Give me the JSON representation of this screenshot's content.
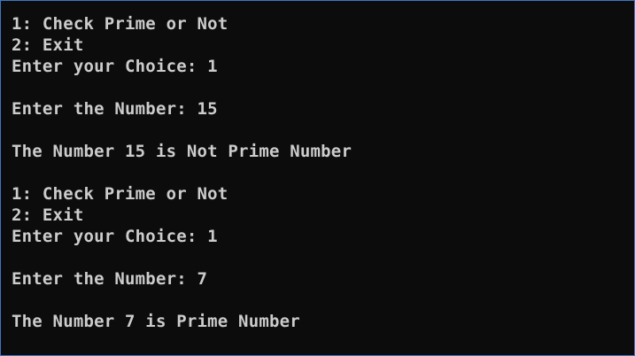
{
  "console": {
    "colors": {
      "background": "#0c0c0c",
      "text": "#cccccc",
      "border": "#3a78c2"
    },
    "lines": [
      "1: Check Prime or Not",
      "2: Exit",
      "Enter your Choice: 1",
      "",
      "Enter the Number: 15",
      "",
      "The Number 15 is Not Prime Number",
      "",
      "1: Check Prime or Not",
      "2: Exit",
      "Enter your Choice: 1",
      "",
      "Enter the Number: 7",
      "",
      "The Number 7 is Prime Number"
    ]
  }
}
